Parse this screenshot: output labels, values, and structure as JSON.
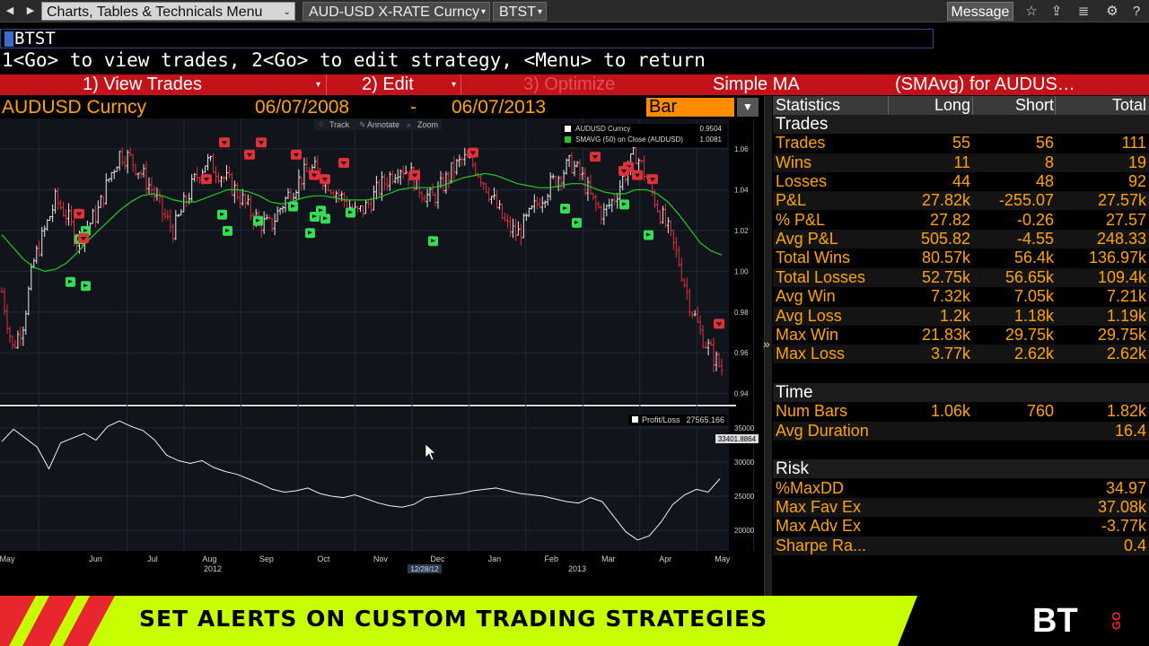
{
  "toolbar": {
    "menu_label": "Charts, Tables & Technicals Menu",
    "security_label": "AUD-USD X-RATE Curncy",
    "function_label": "BTST",
    "message_label": "Message"
  },
  "command": {
    "text": "BTST",
    "hint": "1<Go> to view trades, 2<Go> to edit strategy, <Menu> to return"
  },
  "menu_bar": {
    "view_trades": "1) View Trades",
    "edit": "2) Edit",
    "optimize": "3) Optimize",
    "strategy": "Simple MA",
    "strategy_desc": "(SMAvg) for AUDUS…"
  },
  "chart_header": {
    "symbol": "AUDUSD Curncy",
    "start_date": "06/07/2008",
    "dash": "-",
    "end_date": "06/07/2013",
    "chart_type": "Bar"
  },
  "chart_tools": {
    "track": "Track",
    "annotate": "Annotate",
    "zoom": "Zoom"
  },
  "chart_data": {
    "type": "bar",
    "price_panel": {
      "ylim": [
        0.935,
        1.075
      ],
      "yticks": [
        "1.06",
        "1.04",
        "1.02",
        "1.00",
        "0.98",
        "0.96",
        "0.94"
      ],
      "legend": [
        {
          "name": "AUDUSD Curncy",
          "last": "0.9504",
          "color": "#ffffff"
        },
        {
          "name": "SMAVG (50) on Close (AUDUSD)",
          "last": "1.0081",
          "color": "#22cc22"
        }
      ],
      "close": [
        0.99,
        0.962,
        0.975,
        1.005,
        1.02,
        1.035,
        1.028,
        1.015,
        1.022,
        1.03,
        1.046,
        1.058,
        1.055,
        1.048,
        1.04,
        1.028,
        1.02,
        1.033,
        1.045,
        1.054,
        1.05,
        1.044,
        1.038,
        1.03,
        1.024,
        1.022,
        1.032,
        1.04,
        1.047,
        1.05,
        1.046,
        1.04,
        1.034,
        1.028,
        1.032,
        1.04,
        1.046,
        1.052,
        1.048,
        1.04,
        1.035,
        1.042,
        1.05,
        1.055,
        1.052,
        1.043,
        1.032,
        1.022,
        1.018,
        1.026,
        1.035,
        1.042,
        1.048,
        1.053,
        1.046,
        1.034,
        1.028,
        1.036,
        1.048,
        1.058,
        1.046,
        1.032,
        1.02,
        1.005,
        0.985,
        0.97,
        0.96,
        0.952
      ],
      "sma": [
        1.018,
        1.012,
        1.006,
        1.002,
        1.0,
        1.001,
        1.004,
        1.009,
        1.015,
        1.02,
        1.025,
        1.03,
        1.034,
        1.037,
        1.038,
        1.037,
        1.035,
        1.034,
        1.034,
        1.036,
        1.038,
        1.04,
        1.04,
        1.039,
        1.037,
        1.034,
        1.033,
        1.034,
        1.036,
        1.037,
        1.037,
        1.036,
        1.035,
        1.035,
        1.035,
        1.036,
        1.038,
        1.04,
        1.041,
        1.041,
        1.041,
        1.042,
        1.044,
        1.046,
        1.047,
        1.048,
        1.047,
        1.045,
        1.043,
        1.042,
        1.041,
        1.041,
        1.042,
        1.043,
        1.043,
        1.041,
        1.039,
        1.038,
        1.038,
        1.04,
        1.04,
        1.038,
        1.034,
        1.028,
        1.021,
        1.014,
        1.01,
        1.008
      ],
      "buy_signals": [
        0.995,
        0.993,
        1.028,
        1.02,
        1.025,
        1.032,
        1.019,
        1.027,
        1.03,
        1.026,
        1.029,
        1.015,
        1.031,
        1.024,
        1.033,
        1.018,
        1.016,
        1.02
      ],
      "sell_signals": [
        1.028,
        1.016,
        1.063,
        1.045,
        1.057,
        1.063,
        1.057,
        1.047,
        1.045,
        1.053,
        1.047,
        1.058,
        1.063,
        1.056,
        1.065,
        1.051,
        1.045,
        1.047,
        1.049,
        0.974
      ]
    },
    "pnl_panel": {
      "name": "Profit/Loss",
      "last": "27565.166",
      "marker": "33401.8864",
      "ylim": [
        17000,
        38000
      ],
      "yticks": [
        "35000",
        "30000",
        "25000",
        "20000"
      ],
      "values": [
        33000,
        34800,
        33500,
        32200,
        29000,
        32800,
        33500,
        34200,
        33200,
        35200,
        36000,
        35200,
        34600,
        33200,
        31000,
        30200,
        29800,
        30200,
        29200,
        28600,
        28200,
        27500,
        26800,
        26000,
        25600,
        25800,
        26200,
        25400,
        25000,
        24800,
        25200,
        24600,
        24000,
        23600,
        23400,
        23800,
        24800,
        25000,
        25200,
        25400,
        25800,
        26000,
        26200,
        25800,
        25400,
        25200,
        25000,
        24600,
        24200,
        24000,
        24800,
        24200,
        22000,
        19800,
        18600,
        19200,
        21200,
        23800,
        25200,
        26000,
        25600,
        27565
      ]
    },
    "x_months": [
      "May",
      "Jun",
      "Jul",
      "Aug",
      "Sep",
      "Oct",
      "Nov",
      "Dec",
      "Jan",
      "Feb",
      "Mar",
      "Apr",
      "May"
    ],
    "x_years": [
      "2012",
      "2013"
    ],
    "x_marker": "12/28/12"
  },
  "stats": {
    "columns": [
      "Statistics",
      "Long",
      "Short",
      "Total"
    ],
    "trades_title": "Trades",
    "trades": [
      {
        "label": "Trades",
        "long": "55",
        "short": "56",
        "total": "111"
      },
      {
        "label": "Wins",
        "long": "11",
        "short": "8",
        "total": "19"
      },
      {
        "label": "Losses",
        "long": "44",
        "short": "48",
        "total": "92"
      },
      {
        "label": "P&L",
        "long": "27.82k",
        "short": "-255.07",
        "total": "27.57k"
      },
      {
        "label": "% P&L",
        "long": "27.82",
        "short": "-0.26",
        "total": "27.57"
      },
      {
        "label": "Avg P&L",
        "long": "505.82",
        "short": "-4.55",
        "total": "248.33"
      },
      {
        "label": "Total Wins",
        "long": "80.57k",
        "short": "56.4k",
        "total": "136.97k"
      },
      {
        "label": "Total Losses",
        "long": "52.75k",
        "short": "56.65k",
        "total": "109.4k"
      },
      {
        "label": "Avg Win",
        "long": "7.32k",
        "short": "7.05k",
        "total": "7.21k"
      },
      {
        "label": "Avg Loss",
        "long": "1.2k",
        "short": "1.18k",
        "total": "1.19k"
      },
      {
        "label": "Max Win",
        "long": "21.83k",
        "short": "29.75k",
        "total": "29.75k"
      },
      {
        "label": "Max Loss",
        "long": "3.77k",
        "short": "2.62k",
        "total": "2.62k"
      }
    ],
    "time_title": "Time",
    "time": [
      {
        "label": "Num Bars",
        "long": "1.06k",
        "short": "760",
        "total": "1.82k"
      },
      {
        "label": "Avg Duration",
        "long": "",
        "short": "",
        "total": "16.4"
      }
    ],
    "risk_title": "Risk",
    "risk": [
      {
        "label": "%MaxDD",
        "total": "34.97"
      },
      {
        "label": "Max Fav Ex",
        "total": "37.08k"
      },
      {
        "label": "Max Adv Ex",
        "total": "-3.77k"
      },
      {
        "label": "Sharpe Ra...",
        "total": "0.4"
      }
    ]
  },
  "banner": {
    "text": "SET ALERTS ON CUSTOM TRADING STRATEGIES",
    "logo": "BT",
    "go": "GO"
  },
  "colors": {
    "accent": "#ffa400",
    "menu_red": "#c4121a",
    "banner_green": "#c8ff00",
    "sma": "#22cc22",
    "buy": "#33dd55",
    "sell": "#e0303a"
  }
}
